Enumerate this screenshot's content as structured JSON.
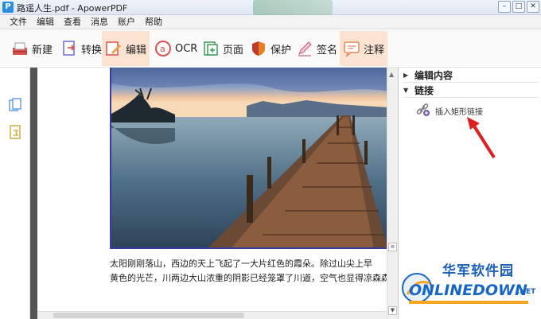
{
  "window": {
    "title": "路遥人生.pdf - ApowerPDF",
    "app_icon": "P"
  },
  "menu": [
    "文件",
    "编辑",
    "查看",
    "消息",
    "账户",
    "帮助"
  ],
  "toolbar": {
    "new": "新建",
    "convert": "转换",
    "edit": "编辑",
    "ocr": "OCR",
    "page": "页面",
    "protect": "保护",
    "sign": "签名",
    "annotate": "注释"
  },
  "sidebar": {
    "edit_content": "编辑内容",
    "links": "链接",
    "insert_rect_link": "插入矩形链接"
  },
  "document": {
    "para_line1": "太阳刚刚落山，西边的天上飞起了一大片红色的霞朵。除过山尖上早",
    "para_line2": "黄色的光芒，川两边大山浓重的阴影已经笼罩了川道，空气也显得凉森森"
  },
  "watermark": {
    "cn": "华军软件园",
    "en": "ONLINEDOWN",
    "net": ".NET"
  },
  "colors": {
    "accent": "#fbe3d1",
    "arrow": "#e02020",
    "brand": "#1766c7"
  }
}
